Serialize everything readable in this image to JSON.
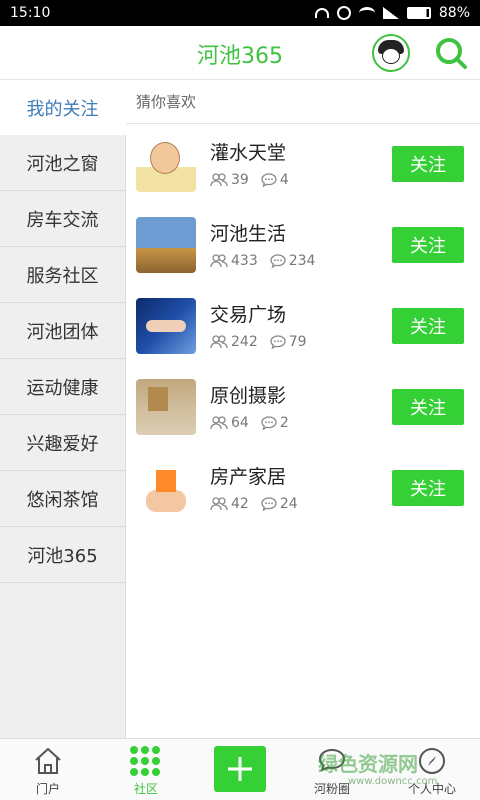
{
  "status": {
    "time": "15:10",
    "battery": "88%"
  },
  "header": {
    "title": "河池365"
  },
  "sidebar": {
    "items": [
      {
        "label": "我的关注"
      },
      {
        "label": "河池之窗"
      },
      {
        "label": "房车交流"
      },
      {
        "label": "服务社区"
      },
      {
        "label": "河池团体"
      },
      {
        "label": "运动健康"
      },
      {
        "label": "兴趣爱好"
      },
      {
        "label": "悠闲茶馆"
      },
      {
        "label": "河池365"
      }
    ]
  },
  "content": {
    "section_title": "猜你喜欢",
    "follow_label": "关注",
    "forums": [
      {
        "title": "灌水天堂",
        "members": "39",
        "posts": "4"
      },
      {
        "title": "河池生活",
        "members": "433",
        "posts": "234"
      },
      {
        "title": "交易广场",
        "members": "242",
        "posts": "79"
      },
      {
        "title": "原创摄影",
        "members": "64",
        "posts": "2"
      },
      {
        "title": "房产家居",
        "members": "42",
        "posts": "24"
      }
    ]
  },
  "nav": {
    "portal": "门户",
    "community": "社区",
    "fans": "河粉圈",
    "profile": "个人中心"
  },
  "watermark": {
    "text": "绿色资源网",
    "url": "www.downcc.com"
  },
  "colors": {
    "accent": "#35d035",
    "active_sidebar": "#3e7db8"
  }
}
